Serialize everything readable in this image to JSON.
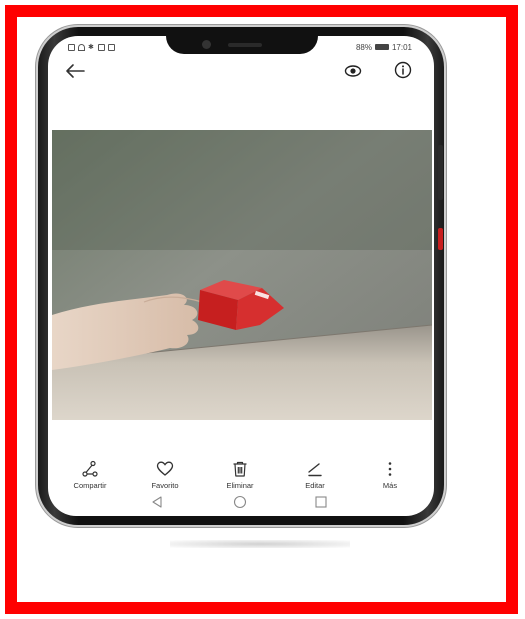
{
  "status_bar": {
    "battery": "88%",
    "time": "17:01"
  },
  "icons": {
    "back": "arrow-left-icon",
    "view": "eye-icon",
    "info": "info-icon"
  },
  "photo": {
    "description_icon": "photo-image"
  },
  "actions": [
    {
      "label": "Compartir",
      "icon": "share-icon"
    },
    {
      "label": "Favorito",
      "icon": "heart-icon"
    },
    {
      "label": "Eliminar",
      "icon": "trash-icon"
    },
    {
      "label": "Editar",
      "icon": "edit-icon"
    },
    {
      "label": "Más",
      "icon": "more-vertical-icon"
    }
  ],
  "nav": {
    "back": "nav-back-icon",
    "home": "nav-home-icon",
    "recents": "nav-recents-icon"
  },
  "colors": {
    "frame_border": "#ff0000",
    "phone_body": "#111111",
    "cube": "#d92b2b"
  }
}
